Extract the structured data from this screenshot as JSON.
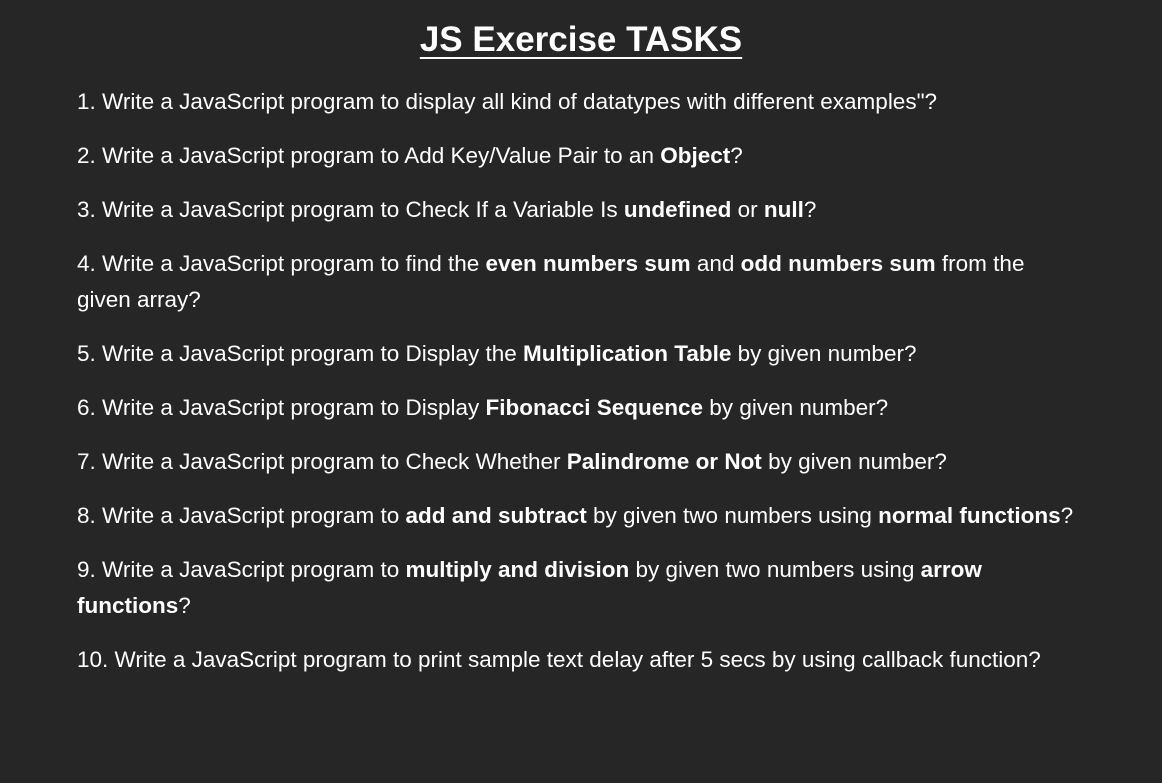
{
  "document": {
    "title": "JS Exercise TASKS",
    "tasks": [
      {
        "segments": [
          {
            "text": "1. Write a JavaScript program to display all kind of datatypes with different examples\"?",
            "bold": false
          }
        ]
      },
      {
        "segments": [
          {
            "text": "2. Write a JavaScript program to Add Key/Value Pair to an ",
            "bold": false
          },
          {
            "text": "Object",
            "bold": true
          },
          {
            "text": "?",
            "bold": false
          }
        ]
      },
      {
        "segments": [
          {
            "text": "3. Write a JavaScript program to Check If a Variable Is ",
            "bold": false
          },
          {
            "text": "undefined",
            "bold": true
          },
          {
            "text": " or ",
            "bold": false
          },
          {
            "text": "null",
            "bold": true
          },
          {
            "text": "?",
            "bold": false
          }
        ]
      },
      {
        "segments": [
          {
            "text": "4. Write a JavaScript program to find the ",
            "bold": false
          },
          {
            "text": "even numbers sum",
            "bold": true
          },
          {
            "text": " and ",
            "bold": false
          },
          {
            "text": "odd numbers sum",
            "bold": true
          },
          {
            "text": " from the given array?",
            "bold": false
          }
        ]
      },
      {
        "segments": [
          {
            "text": "5. Write a JavaScript program to Display the ",
            "bold": false
          },
          {
            "text": "Multiplication Table",
            "bold": true
          },
          {
            "text": " by given number?",
            "bold": false
          }
        ]
      },
      {
        "segments": [
          {
            "text": "6. Write a JavaScript program to Display ",
            "bold": false
          },
          {
            "text": "Fibonacci Sequence",
            "bold": true
          },
          {
            "text": " by given number?",
            "bold": false
          }
        ]
      },
      {
        "segments": [
          {
            "text": "7. Write a JavaScript program to Check Whether ",
            "bold": false
          },
          {
            "text": "Palindrome or Not",
            "bold": true
          },
          {
            "text": " by given number?",
            "bold": false
          }
        ]
      },
      {
        "segments": [
          {
            "text": "8. Write a JavaScript program to ",
            "bold": false
          },
          {
            "text": "add and subtract",
            "bold": true
          },
          {
            "text": " by given two numbers using ",
            "bold": false
          },
          {
            "text": "normal functions",
            "bold": true
          },
          {
            "text": "?",
            "bold": false
          }
        ]
      },
      {
        "segments": [
          {
            "text": "9. Write a JavaScript program to ",
            "bold": false
          },
          {
            "text": "multiply and division",
            "bold": true
          },
          {
            "text": " by given two numbers using ",
            "bold": false
          },
          {
            "text": "arrow functions",
            "bold": true
          },
          {
            "text": "?",
            "bold": false
          }
        ]
      },
      {
        "segments": [
          {
            "text": "10. Write a JavaScript program to print sample text delay after 5 secs by using callback function?",
            "bold": false
          }
        ]
      }
    ]
  },
  "colors": {
    "background": "#262626",
    "text": "#ffffff"
  }
}
